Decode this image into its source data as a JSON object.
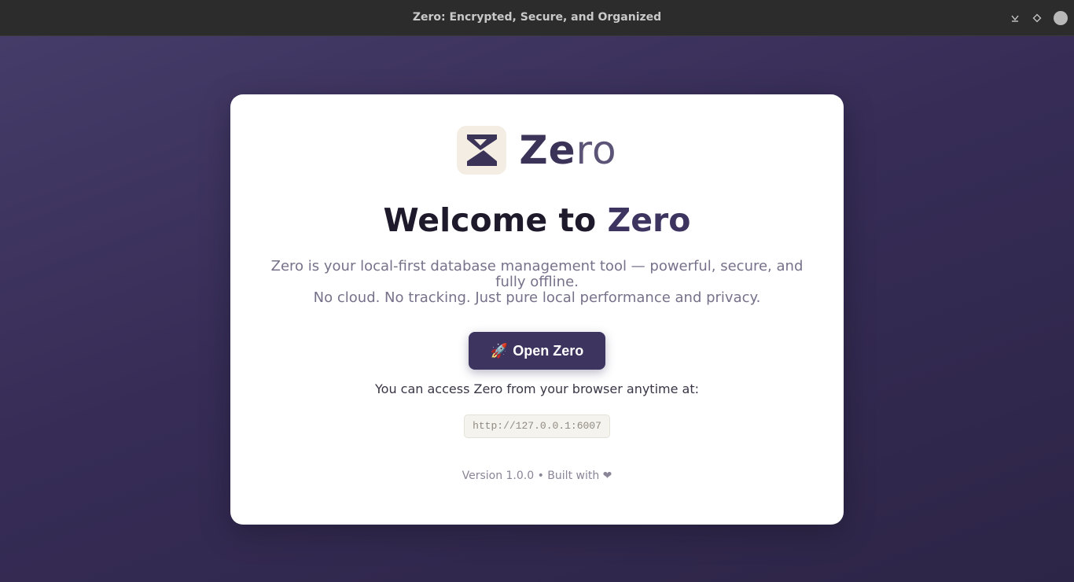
{
  "window": {
    "title": "Zero: Encrypted, Secure, and Organized",
    "controls": {
      "minimize_icon": "minimize-icon",
      "maximize_icon": "maximize-icon",
      "close_icon": "close-icon"
    }
  },
  "card": {
    "brand": {
      "name_bold": "Ze",
      "name_light": "ro",
      "logo_icon": "zero-logo-icon"
    },
    "heading": {
      "prefix": "Welcome to ",
      "accent": "Zero"
    },
    "description": {
      "line1": "Zero is your local-first database management tool — powerful, secure, and fully offline.",
      "line2": "No cloud. No tracking. Just pure local performance and privacy."
    },
    "open_button": {
      "icon": "🚀",
      "label": "Open Zero"
    },
    "access_text": "You can access Zero from your browser anytime at:",
    "url": "http://127.0.0.1:6007",
    "footer": "Version 1.0.0 • Built with ❤"
  },
  "colors": {
    "accent": "#3d3460",
    "background": "#2f2846",
    "logo_bg": "#f3ede3"
  }
}
